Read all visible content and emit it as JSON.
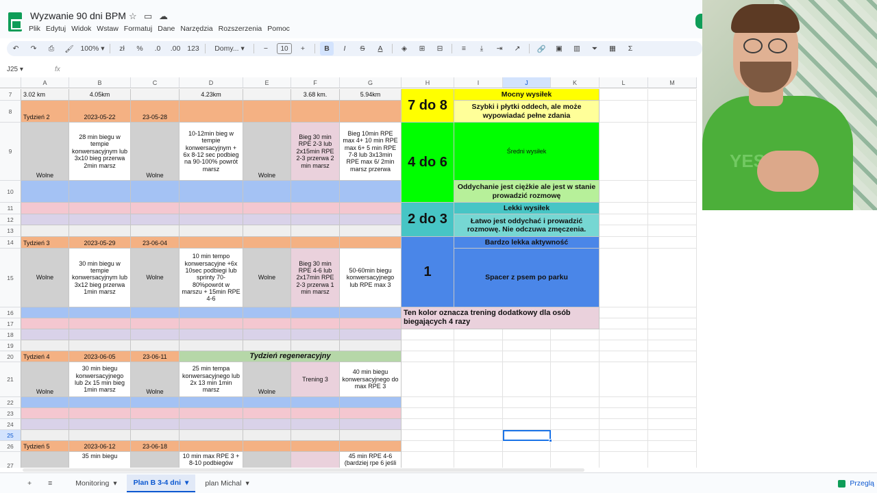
{
  "app": {
    "title": "Wyzwanie 90 dni BPM",
    "menu": [
      "Plik",
      "Edytuj",
      "Widok",
      "Wstaw",
      "Formatuj",
      "Dane",
      "Narzędzia",
      "Rozszerzenia",
      "Pomoc"
    ]
  },
  "toolbar": {
    "zoom": "100%",
    "currency": "zł",
    "percent": "%",
    "dec_less": ".0",
    "dec_more": ".00",
    "num_format": "123",
    "font": "Domy...",
    "font_size": "10",
    "bold": "B",
    "italic": "I",
    "strike": "S",
    "text_color": "A",
    "sigma": "Σ"
  },
  "formula": {
    "name_box": "J25",
    "fx": "fx"
  },
  "columns": [
    "A",
    "B",
    "C",
    "D",
    "E",
    "F",
    "G",
    "H",
    "I",
    "J",
    "K",
    "L",
    "M"
  ],
  "selected_column": "J",
  "rows": [
    "7",
    "8",
    "9",
    "10",
    "11",
    "12",
    "13",
    "14",
    "15",
    "16",
    "17",
    "18",
    "19",
    "20",
    "21",
    "22",
    "23",
    "24",
    "25",
    "26",
    "27"
  ],
  "selected_row": "25",
  "cells": {
    "r7": {
      "A": "3.02 km",
      "B": "4.05km",
      "D": "4.23km",
      "F": "3.68 km.",
      "G": "5.94km"
    },
    "r8": {
      "A": "Tydzień 2",
      "B": "2023-05-22",
      "C": "23-05-28"
    },
    "r9": {
      "A": "Wolne",
      "B": "28 min biegu w tempie konwersacyjnym lub 3x10 bieg przerwa 2min marsz",
      "C": "Wolne",
      "D": "10-12min bieg w tempie konwersacyjnym + 6x 8-12 sec podbieg na 90-100% powrót marsz",
      "E": "Wolne",
      "F": "Bieg 30 min RPE 2-3 lub 2x15min RPE 2-3 przerwa 2 min marsz",
      "G": "Bieg 10min RPE max 4+ 10 min RPE max 6+ 5 min RPE 7-8 lub 3x13min RPE max 6/ 2min marsz przerwa"
    },
    "r14": {
      "A": "Tydzień 3",
      "B": "2023-05-29",
      "C": "23-06-04"
    },
    "r15": {
      "A": "Wolne",
      "B": "30 min biegu w tempie konwersacyjnym lub 3x12 bieg przerwa 1min marsz",
      "C": "Wolne",
      "D": "10 min tempo konwersacyjne +6x 10sec podbiegi lub sprinty 70-80%powrót w marszu + 15min RPE 4-6",
      "E": "Wolne",
      "F": "Bieg 30 min RPE 4-6 lub 2x17min RPE 2-3 przerwa 1 min marsz",
      "G": "50-60min biegu konwersacyjnego lub RPE max 3"
    },
    "r20": {
      "A": "Tydzień 4",
      "B": "2023-06-05",
      "C": "23-06-11",
      "D": "Tydzień regeneracyjny"
    },
    "r21": {
      "A": "Wolne",
      "B": "30 min biegu konwersacyjnego lub 2x 15 min bieg 1min marsz",
      "C": "Wolne",
      "D": "25 min tempa konwersacyjnego lub 2x 13 min 1min marsz",
      "E": "Wolne",
      "F": "Trening 3",
      "G": "40 min biegu konwersacyjnego do max RPE 3"
    },
    "r26": {
      "A": "Tydzień 5",
      "B": "2023-06-12",
      "C": "23-06-18"
    },
    "r27": {
      "B": "35 min biegu",
      "D": "10 min max RPE 3 + 8-10 podbiegów",
      "G": "45 min RPE 4-6 (bardziej rpe 6 jeśli"
    }
  },
  "legend": {
    "rpe_7_8": "7 do 8",
    "rpe_4_6": "4 do 6",
    "rpe_2_3": "2 do 3",
    "rpe_1": "1",
    "mocny": "Mocny wysiłek",
    "mocny_desc": "Szybki i płytki oddech, ale może wypowiadać pełne zdania",
    "sredni": "Średni wysiłek",
    "sredni_desc": "Oddychanie jest ciężkie ale jest w stanie prowadzić rozmowę",
    "lekki": "Lekki wysiłek",
    "lekki_desc": "Łatwo jest oddychać i prowadzić rozmowę. Nie odczuwa zmęczenia.",
    "bardzo_lekka": "Bardzo lekka aktywność",
    "bardzo_lekka_desc": "Spacer z psem po parku",
    "note": "Ten kolor oznacza trening dodatkowy dla osób biegających 4 razy"
  },
  "sheets": {
    "tabs": [
      "Monitoring",
      "Plan B 3-4 dni",
      "plan Michal"
    ],
    "active": "Plan B 3-4 dni",
    "explore": "Przeglą"
  },
  "colors": {
    "orange": "#f4b183",
    "blue": "#a4c2f4",
    "pink": "#ead1dc",
    "rowpink": "#f4c7d0",
    "lavender": "#d9d2e9",
    "grey": "#d0d0d0",
    "green_light": "#b6d7a8",
    "yellow": "#ffff00",
    "yellow_light": "#ffff99",
    "green": "#00ff00",
    "green_pale": "#b7f09a",
    "teal": "#47c5c5",
    "teal_light": "#76d7d3",
    "blue_dark": "#4a86e8"
  }
}
